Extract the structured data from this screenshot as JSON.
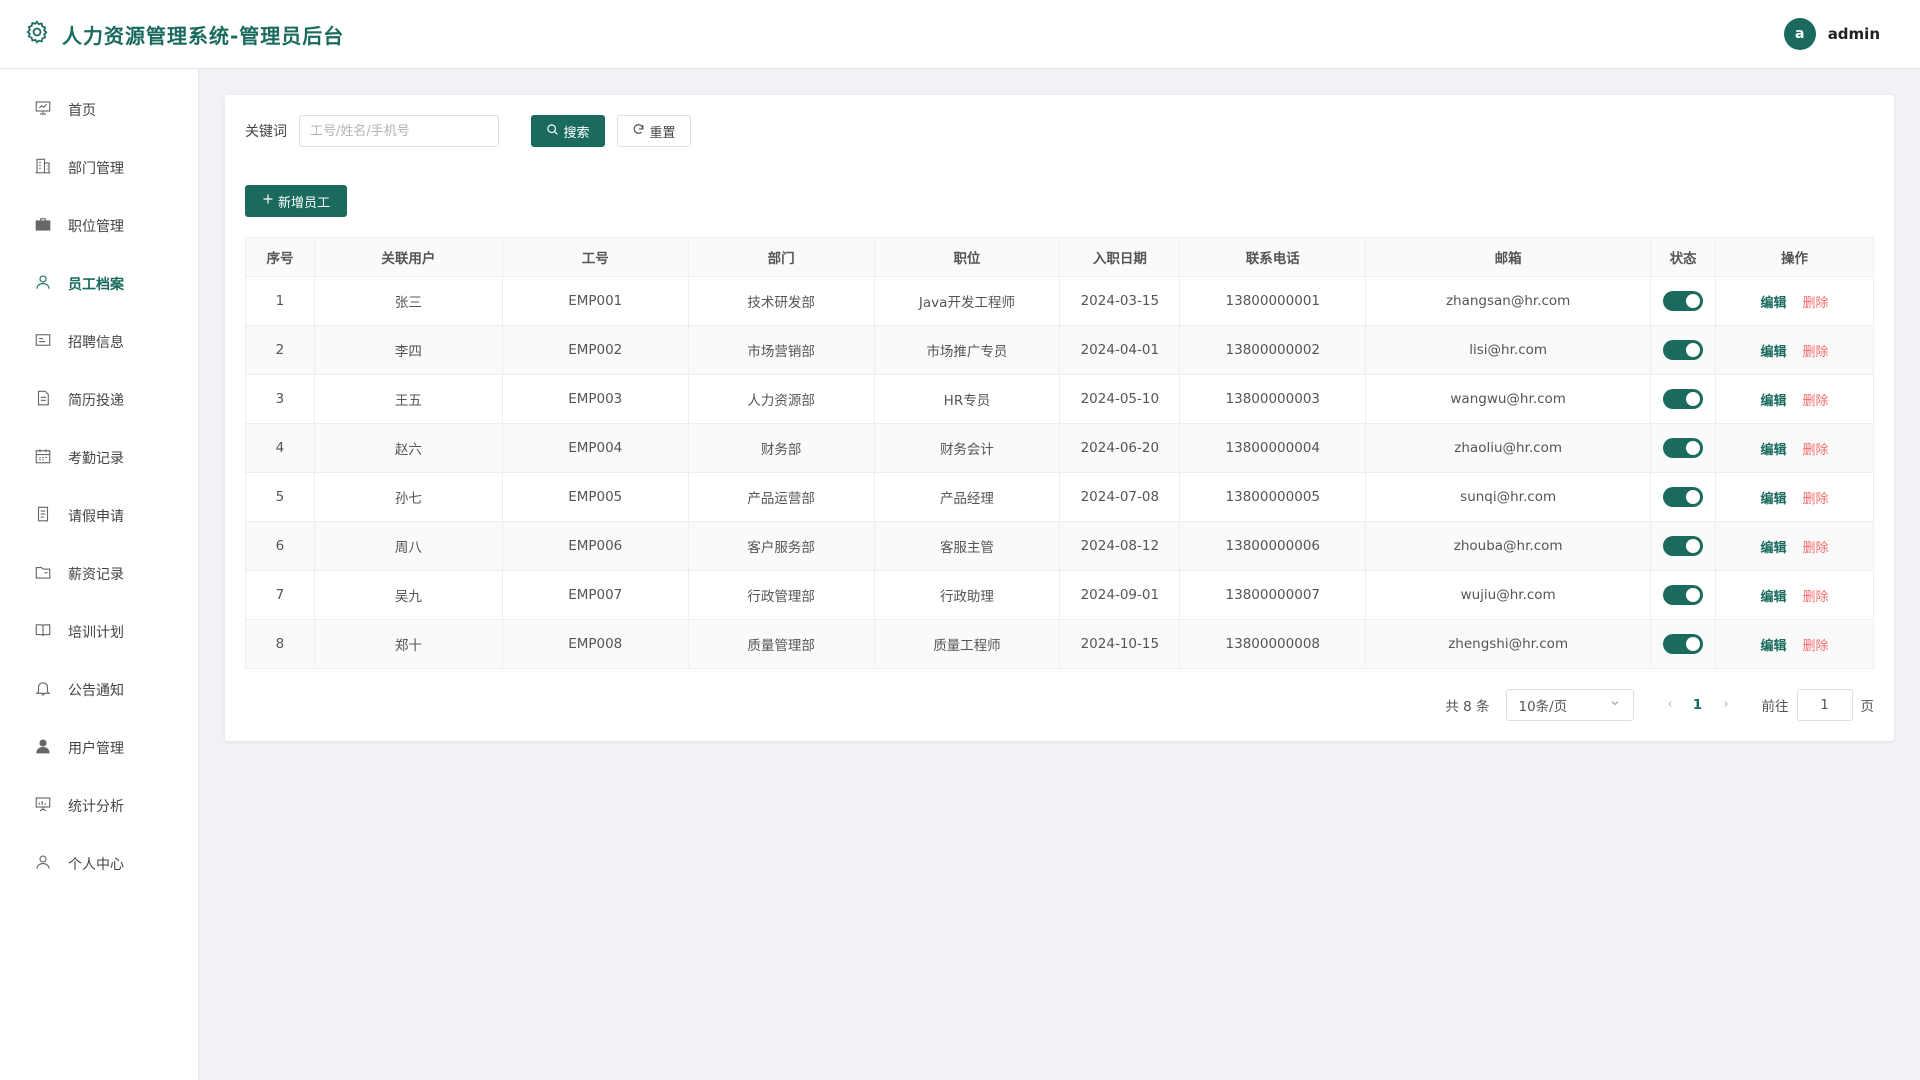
{
  "header": {
    "title": "人力资源管理系统-管理员后台",
    "avatar_letter": "a",
    "username": "admin"
  },
  "sidebar": {
    "items": [
      {
        "label": "首页",
        "icon": "home-chart-icon",
        "active": false
      },
      {
        "label": "部门管理",
        "icon": "building-icon",
        "active": false
      },
      {
        "label": "职位管理",
        "icon": "briefcase-icon",
        "active": false
      },
      {
        "label": "员工档案",
        "icon": "user-icon",
        "active": true
      },
      {
        "label": "招聘信息",
        "icon": "id-card-icon",
        "active": false
      },
      {
        "label": "简历投递",
        "icon": "document-icon",
        "active": false
      },
      {
        "label": "考勤记录",
        "icon": "calendar-icon",
        "active": false
      },
      {
        "label": "请假申请",
        "icon": "tickets-icon",
        "active": false
      },
      {
        "label": "薪资记录",
        "icon": "folder-icon",
        "active": false
      },
      {
        "label": "培训计划",
        "icon": "book-icon",
        "active": false
      },
      {
        "label": "公告通知",
        "icon": "bell-icon",
        "active": false
      },
      {
        "label": "用户管理",
        "icon": "user-filled-icon",
        "active": false
      },
      {
        "label": "统计分析",
        "icon": "presentation-icon",
        "active": false
      },
      {
        "label": "个人中心",
        "icon": "user-icon",
        "active": false
      }
    ]
  },
  "search": {
    "label": "关键词",
    "placeholder": "工号/姓名/手机号",
    "value": "",
    "search_label": "搜索",
    "reset_label": "重置"
  },
  "add_button_label": "新增员工",
  "table": {
    "columns": [
      "序号",
      "关联用户",
      "工号",
      "部门",
      "职位",
      "入职日期",
      "联系电话",
      "邮箱",
      "状态",
      "操作"
    ],
    "rows": [
      {
        "index": "1",
        "user": "张三",
        "emp_no": "EMP001",
        "dept": "技术研发部",
        "position": "Java开发工程师",
        "date": "2024-03-15",
        "phone": "13800000001",
        "email": "zhangsan@hr.com",
        "status": true
      },
      {
        "index": "2",
        "user": "李四",
        "emp_no": "EMP002",
        "dept": "市场营销部",
        "position": "市场推广专员",
        "date": "2024-04-01",
        "phone": "13800000002",
        "email": "lisi@hr.com",
        "status": true
      },
      {
        "index": "3",
        "user": "王五",
        "emp_no": "EMP003",
        "dept": "人力资源部",
        "position": "HR专员",
        "date": "2024-05-10",
        "phone": "13800000003",
        "email": "wangwu@hr.com",
        "status": true
      },
      {
        "index": "4",
        "user": "赵六",
        "emp_no": "EMP004",
        "dept": "财务部",
        "position": "财务会计",
        "date": "2024-06-20",
        "phone": "13800000004",
        "email": "zhaoliu@hr.com",
        "status": true
      },
      {
        "index": "5",
        "user": "孙七",
        "emp_no": "EMP005",
        "dept": "产品运营部",
        "position": "产品经理",
        "date": "2024-07-08",
        "phone": "13800000005",
        "email": "sunqi@hr.com",
        "status": true
      },
      {
        "index": "6",
        "user": "周八",
        "emp_no": "EMP006",
        "dept": "客户服务部",
        "position": "客服主管",
        "date": "2024-08-12",
        "phone": "13800000006",
        "email": "zhouba@hr.com",
        "status": true
      },
      {
        "index": "7",
        "user": "吴九",
        "emp_no": "EMP007",
        "dept": "行政管理部",
        "position": "行政助理",
        "date": "2024-09-01",
        "phone": "13800000007",
        "email": "wujiu@hr.com",
        "status": true
      },
      {
        "index": "8",
        "user": "郑十",
        "emp_no": "EMP008",
        "dept": "质量管理部",
        "position": "质量工程师",
        "date": "2024-10-15",
        "phone": "13800000008",
        "email": "zhengshi@hr.com",
        "status": true
      }
    ],
    "edit_label": "编辑",
    "delete_label": "删除"
  },
  "pagination": {
    "total_text": "共 8 条",
    "page_size": "10条/页",
    "current_page": "1",
    "goto_label": "前往",
    "goto_value": "1",
    "goto_suffix": "页"
  },
  "colors": {
    "accent": "#1a6b5e",
    "danger": "#f56c6c"
  }
}
